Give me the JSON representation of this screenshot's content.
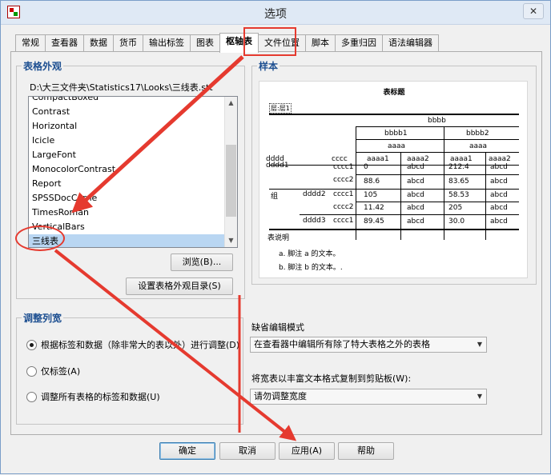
{
  "window": {
    "title": "选项",
    "close_glyph": "✕"
  },
  "tabs": [
    {
      "label": "常规"
    },
    {
      "label": "查看器"
    },
    {
      "label": "数据"
    },
    {
      "label": "货币"
    },
    {
      "label": "输出标签"
    },
    {
      "label": "图表"
    },
    {
      "label": "枢轴表",
      "active": true
    },
    {
      "label": "文件位置"
    },
    {
      "label": "脚本"
    },
    {
      "label": "多重归因"
    },
    {
      "label": "语法编辑器"
    }
  ],
  "table_looks": {
    "group_label": "表格外观",
    "path": "D:\\大三文件夹\\Statistics17\\Looks\\三线表.stt",
    "items": [
      "CompactBoxed",
      "Contrast",
      "Horizontal",
      "Icicle",
      "LargeFont",
      "MonocolorContrast",
      "Report",
      "SPSSDocCorne",
      "TimesRoman",
      "VerticalBars",
      "三线表"
    ],
    "selected": "三线表",
    "browse_label": "浏览(B)...",
    "set_dir_label": "设置表格外观目录(S)"
  },
  "sample": {
    "group_label": "样本",
    "title": "表标题",
    "caption": "层:层1",
    "h_bbbb": "bbbb",
    "h_bbbb1": "bbbb1",
    "h_bbbb2": "bbbb2",
    "h_aaaa": "aaaa",
    "h_dddd": "dddd",
    "h_cccc": "cccc",
    "h_aaaa1": "aaaa1",
    "h_aaaa2": "aaaa2",
    "r_dddd1": "dddd1",
    "r_group": "组",
    "r_dddd2": "dddd2",
    "r_dddd3": "dddd3",
    "c_cccc1": "cccc1",
    "c_cccc2": "cccc2",
    "v_0": "0",
    "v_886": "88.6",
    "v_105": "105",
    "v_1142": "11.42",
    "v_8945": "89.45",
    "v_2124": "212.4",
    "v_8365": "83.65",
    "v_5853": "58.53",
    "v_205": "205",
    "v_300": "30.0",
    "v_abcd": "abcd",
    "note_title": "表说明",
    "note_a": "a. 脚注 a 的文本。",
    "note_b": "b. 脚注 b 的文本。."
  },
  "column_width": {
    "group_label": "调整列宽",
    "opt1": "根据标签和数据（除非常大的表以外）进行调整(D)",
    "opt2": "仅标签(A)",
    "opt3": "调整所有表格的标签和数据(U)"
  },
  "edit_mode": {
    "label": "缺省编辑模式",
    "value": "在查看器中编辑所有除了特大表格之外的表格",
    "arrow_glyph": "▼"
  },
  "copy_mode": {
    "label": "将宽表以丰富文本格式复制到剪贴板(W):",
    "value": "请勿调整宽度",
    "arrow_glyph": "▼"
  },
  "buttons": {
    "ok": "确定",
    "cancel": "取消",
    "apply": "应用(A)",
    "help": "帮助"
  },
  "scroll": {
    "up": "▲",
    "down": "▼"
  },
  "colors": {
    "annotation": "#e53a2f",
    "group_label": "#1d4f91",
    "selected": "#b9d6f2"
  }
}
